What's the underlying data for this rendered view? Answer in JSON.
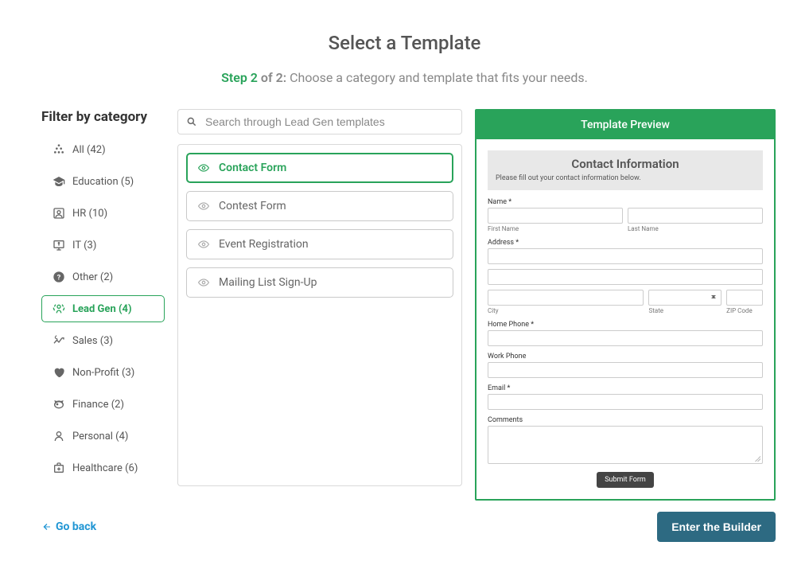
{
  "header": {
    "title": "Select a Template",
    "step_label": "Step 2",
    "of_label": "of 2:",
    "subtitle_rest": "Choose a category and template that fits your needs."
  },
  "sidebar": {
    "filter_title": "Filter by category",
    "categories": [
      {
        "label": "All (42)",
        "icon": "all"
      },
      {
        "label": "Education (5)",
        "icon": "education"
      },
      {
        "label": "HR (10)",
        "icon": "hr"
      },
      {
        "label": "IT (3)",
        "icon": "it"
      },
      {
        "label": "Other (2)",
        "icon": "other"
      },
      {
        "label": "Lead Gen (4)",
        "icon": "leadgen",
        "active": true
      },
      {
        "label": "Sales (3)",
        "icon": "sales"
      },
      {
        "label": "Non-Profit (3)",
        "icon": "nonprofit"
      },
      {
        "label": "Finance (2)",
        "icon": "finance"
      },
      {
        "label": "Personal (4)",
        "icon": "personal"
      },
      {
        "label": "Healthcare (6)",
        "icon": "healthcare"
      }
    ]
  },
  "search": {
    "placeholder": "Search through Lead Gen templates"
  },
  "templates": [
    {
      "label": "Contact Form",
      "selected": true
    },
    {
      "label": "Contest Form"
    },
    {
      "label": "Event Registration"
    },
    {
      "label": "Mailing List Sign-Up"
    }
  ],
  "preview": {
    "header": "Template Preview",
    "form_title": "Contact Information",
    "form_subtitle": "Please fill out your contact information below.",
    "name_label": "Name *",
    "first_name": "First Name",
    "last_name": "Last Name",
    "address_label": "Address *",
    "city": "City",
    "state": "State",
    "zip": "ZIP Code",
    "home_phone": "Home Phone *",
    "work_phone": "Work Phone",
    "email": "Email *",
    "comments": "Comments",
    "submit": "Submit Form"
  },
  "footer": {
    "go_back": "Go back",
    "enter": "Enter the Builder"
  }
}
